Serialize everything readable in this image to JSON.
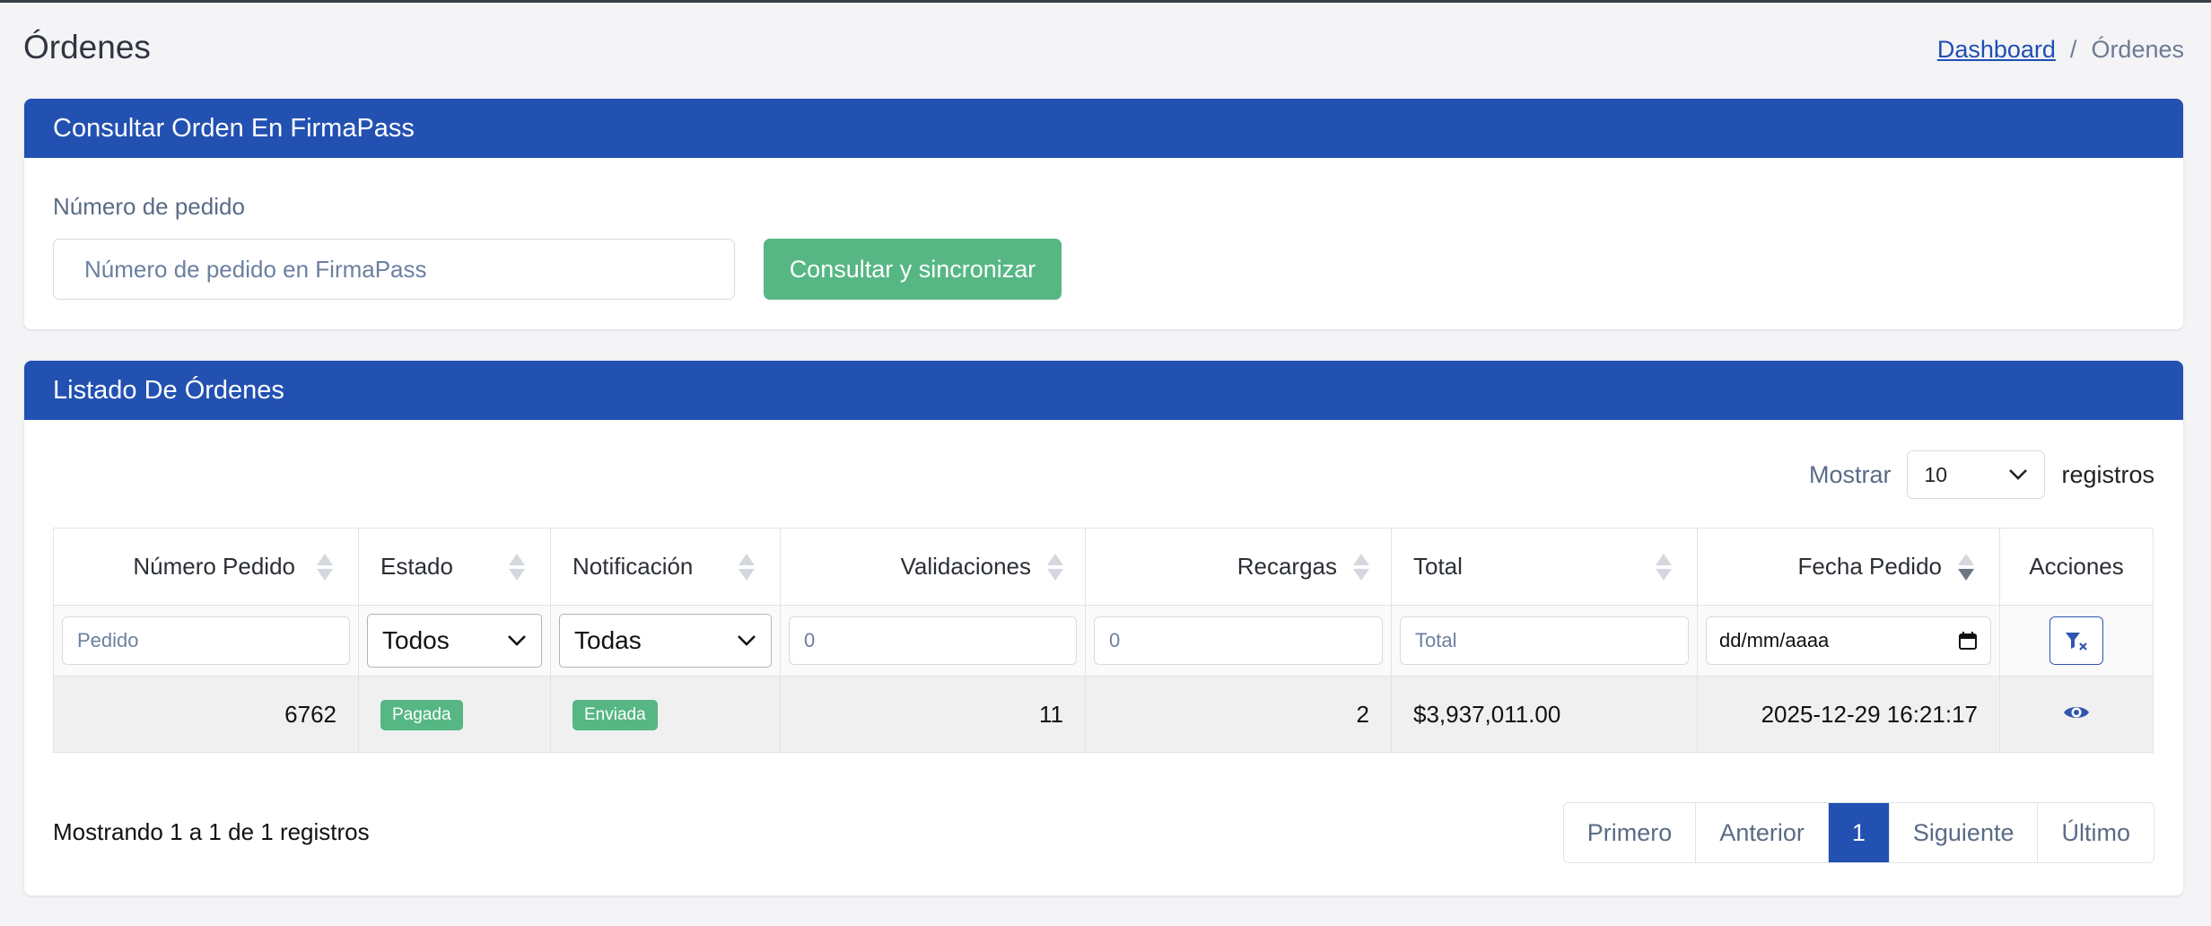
{
  "page": {
    "title": "Órdenes"
  },
  "breadcrumb": {
    "home": "Dashboard",
    "separator": "/",
    "current": "Órdenes"
  },
  "consult_card": {
    "header": "Consultar Orden En FirmaPass",
    "field_label": "Número de pedido",
    "input_placeholder": "Número de pedido en FirmaPass",
    "button_label": "Consultar y sincronizar"
  },
  "list_card": {
    "header": "Listado De Órdenes",
    "length_prefix": "Mostrar",
    "length_value": "10",
    "length_suffix": "registros",
    "columns": [
      "Número Pedido",
      "Estado",
      "Notificación",
      "Validaciones",
      "Recargas",
      "Total",
      "Fecha Pedido",
      "Acciones"
    ],
    "filters": {
      "pedido_placeholder": "Pedido",
      "estado_value": "Todos",
      "notificacion_value": "Todas",
      "validaciones_placeholder": "0",
      "recargas_placeholder": "0",
      "total_placeholder": "Total",
      "fecha_placeholder": "dd/mm/aaaa"
    },
    "rows": [
      {
        "numero_pedido": "6762",
        "estado": "Pagada",
        "notificacion": "Enviada",
        "validaciones": "11",
        "recargas": "2",
        "total": "$3,937,011.00",
        "fecha_pedido": "2025-12-29 16:21:17"
      }
    ],
    "info_text": "Mostrando 1 a 1 de 1 registros",
    "pagination": [
      "Primero",
      "Anterior",
      "1",
      "Siguiente",
      "Último"
    ],
    "active_page": "1"
  },
  "colors": {
    "header_blue": "#2351b2",
    "success_green": "#56b784",
    "page_bg": "#f4f4f7"
  },
  "icons": {
    "clear_filter": "filter-x-icon",
    "view": "eye-icon",
    "dropdown": "chevron-down-icon",
    "calendar": "calendar-icon",
    "sort": "sort-arrows-icon"
  }
}
